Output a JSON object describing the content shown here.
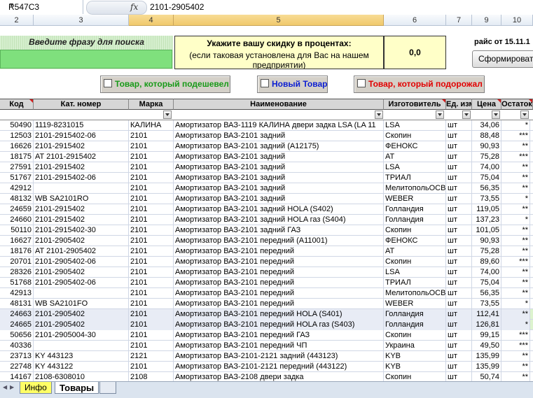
{
  "formula_bar": {
    "name_box": "R547C3",
    "fx_label": "fx",
    "formula": "2101-2905402"
  },
  "column_headers": [
    "2",
    "3",
    "4",
    "5",
    "6",
    "7",
    "9",
    "10"
  ],
  "search": {
    "label": "Введите фразу для поиска",
    "value": ""
  },
  "discount": {
    "title": "Укажите вашу скидку в процентах:",
    "subtitle": "(если таковая установлена для Вас на нашем предприятии)",
    "value": "0,0"
  },
  "price_date": "райс от 15.11.1",
  "form_button": "Сформироват",
  "filters": {
    "cheaper": "Товар, который подешевел",
    "new": "Новый Товар",
    "pricier": "Товар, который подорожал"
  },
  "table_headers": {
    "code": "Код",
    "cat": "Кат. номер",
    "brand": "Марка",
    "name": "Наименование",
    "mfr": "Изготовитель",
    "unit": "Ед. изм",
    "price": "Цена",
    "stock": "Остаток"
  },
  "rows": [
    {
      "code": "50490",
      "cat": "1119-8231015",
      "brand": "КАЛИНА",
      "name": "Амортизатор ВАЗ-1119 КАЛИНА двери задка LSA (LA 11",
      "mfr": "LSA",
      "unit": "шт",
      "price": "34,06",
      "stock": "*"
    },
    {
      "code": "12503",
      "cat": "2101-2915402-06",
      "brand": "2101",
      "name": "Амортизатор ВАЗ-2101 задний",
      "mfr": "Скопин",
      "unit": "шт",
      "price": "88,48",
      "stock": "***"
    },
    {
      "code": "16626",
      "cat": "2101-2915402",
      "brand": "2101",
      "name": "Амортизатор ВАЗ-2101 задний (А12175)",
      "mfr": "ФЕНОКС",
      "unit": "шт",
      "price": "90,93",
      "stock": "**"
    },
    {
      "code": "18175",
      "cat": "AT 2101-2915402",
      "brand": "2101",
      "name": "Амортизатор ВАЗ-2101 задний",
      "mfr": "AT",
      "unit": "шт",
      "price": "75,28",
      "stock": "***"
    },
    {
      "code": "27591",
      "cat": "2101-2915402",
      "brand": "2101",
      "name": "Амортизатор ВАЗ-2101 задний",
      "mfr": "LSA",
      "unit": "шт",
      "price": "74,00",
      "stock": "**"
    },
    {
      "code": "51767",
      "cat": "2101-2915402-06",
      "brand": "2101",
      "name": "Амортизатор ВАЗ-2101 задний",
      "mfr": "ТРИАЛ",
      "unit": "шт",
      "price": "75,04",
      "stock": "**"
    },
    {
      "code": "42912",
      "cat": "",
      "brand": "2101",
      "name": "Амортизатор ВАЗ-2101 задний",
      "mfr": "МелитопольОСВ",
      "unit": "шт",
      "price": "56,35",
      "stock": "**"
    },
    {
      "code": "48132",
      "cat": "WB SA2101RO",
      "brand": "2101",
      "name": "Амортизатор ВАЗ-2101 задний",
      "mfr": "WEBER",
      "unit": "шт",
      "price": "73,55",
      "stock": "*"
    },
    {
      "code": "24659",
      "cat": "2101-2915402",
      "brand": "2101",
      "name": "Амортизатор ВАЗ-2101 задний HOLA (S402)",
      "mfr": "Голландия",
      "unit": "шт",
      "price": "119,05",
      "stock": "**"
    },
    {
      "code": "24660",
      "cat": "2101-2915402",
      "brand": "2101",
      "name": "Амортизатор ВАЗ-2101 задний HOLA газ (S404)",
      "mfr": "Голландия",
      "unit": "шт",
      "price": "137,23",
      "stock": "*"
    },
    {
      "code": "50110",
      "cat": "2101-2915402-30",
      "brand": "2101",
      "name": "Амортизатор ВАЗ-2101 задний ГАЗ",
      "mfr": "Скопин",
      "unit": "шт",
      "price": "101,05",
      "stock": "**"
    },
    {
      "code": "16627",
      "cat": "2101-2905402",
      "brand": "2101",
      "name": "Амортизатор ВАЗ-2101 передний (А11001)",
      "mfr": "ФЕНОКС",
      "unit": "шт",
      "price": "90,93",
      "stock": "**"
    },
    {
      "code": "18176",
      "cat": "AT 2101-2905402",
      "brand": "2101",
      "name": "Амортизатор ВАЗ-2101 передний",
      "mfr": "AT",
      "unit": "шт",
      "price": "75,28",
      "stock": "**"
    },
    {
      "code": "20701",
      "cat": "2101-2905402-06",
      "brand": "2101",
      "name": "Амортизатор ВАЗ-2101 передний",
      "mfr": "Скопин",
      "unit": "шт",
      "price": "89,60",
      "stock": "***"
    },
    {
      "code": "28326",
      "cat": "2101-2905402",
      "brand": "2101",
      "name": "Амортизатор ВАЗ-2101 передний",
      "mfr": "LSA",
      "unit": "шт",
      "price": "74,00",
      "stock": "**"
    },
    {
      "code": "51768",
      "cat": "2101-2905402-06",
      "brand": "2101",
      "name": "Амортизатор ВАЗ-2101 передний",
      "mfr": "ТРИАЛ",
      "unit": "шт",
      "price": "75,04",
      "stock": "**"
    },
    {
      "code": "42913",
      "cat": "",
      "brand": "2101",
      "name": "Амортизатор ВАЗ-2101 передний",
      "mfr": "МелитопольОСВ",
      "unit": "шт",
      "price": "56,35",
      "stock": "**"
    },
    {
      "code": "48131",
      "cat": "WB SA2101FO",
      "brand": "2101",
      "name": "Амортизатор ВАЗ-2101 передний",
      "mfr": "WEBER",
      "unit": "шт",
      "price": "73,55",
      "stock": "*"
    },
    {
      "code": "24663",
      "cat": "2101-2905402",
      "brand": "2101",
      "name": "Амортизатор ВАЗ-2101 передний HOLA (S401)",
      "mfr": "Голландия",
      "unit": "шт",
      "price": "112,41",
      "stock": "**",
      "highlight": true
    },
    {
      "code": "24665",
      "cat": "2101-2905402",
      "brand": "2101",
      "name": "Амортизатор ВАЗ-2101 передний HOLA газ (S403)",
      "mfr": "Голландия",
      "unit": "шт",
      "price": "126,81",
      "stock": "*",
      "highlight": true
    },
    {
      "code": "50656",
      "cat": "2101-2905004-30",
      "brand": "2101",
      "name": "Амортизатор ВАЗ-2101 передний ГАЗ",
      "mfr": "Скопин",
      "unit": "шт",
      "price": "99,15",
      "stock": "***"
    },
    {
      "code": "40336",
      "cat": "",
      "brand": "2101",
      "name": "Амортизатор ВАЗ-2101 передний ЧП",
      "mfr": "Украина",
      "unit": "шт",
      "price": "49,50",
      "stock": "***"
    },
    {
      "code": "23713",
      "cat": "KY 443123",
      "brand": "2121",
      "name": "Амортизатор ВАЗ-2101-2121 задний (443123)",
      "mfr": "KYB",
      "unit": "шт",
      "price": "135,99",
      "stock": "**"
    },
    {
      "code": "22748",
      "cat": "KY 443122",
      "brand": "2101",
      "name": "Амортизатор ВАЗ-2101-2121 передний (443122)",
      "mfr": "KYB",
      "unit": "шт",
      "price": "135,99",
      "stock": "**"
    },
    {
      "code": "14167",
      "cat": "2108-6308010",
      "brand": "2108",
      "name": "Амортизатор ВАЗ-2108 двери задка",
      "mfr": "Скопин",
      "unit": "шт",
      "price": "50,74",
      "stock": "**"
    }
  ],
  "sheet_tabs": {
    "info": "Инфо",
    "goods": "Товары"
  }
}
